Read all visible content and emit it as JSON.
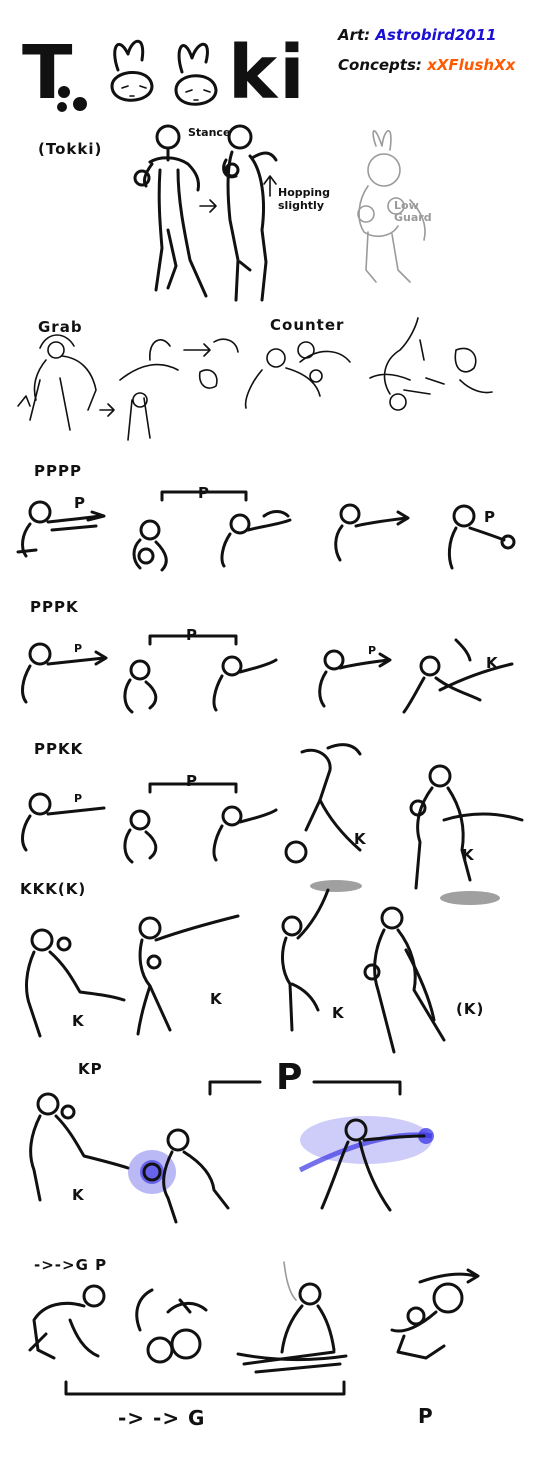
{
  "header": {
    "title_left": "T",
    "title_right": "ki",
    "subtitle": "(Tokki)",
    "art_label": "Art:",
    "art_value": "Astrobird2011",
    "concepts_label": "Concepts:",
    "concepts_value": "xXFlushXx",
    "art_color": "#1a10d6",
    "concepts_color": "#ff5a00"
  },
  "stance": {
    "label": "Stance",
    "hop_note": "Hopping slightly",
    "low_note": "Low Guard"
  },
  "moves": [
    {
      "id": "grab",
      "label": "Grab"
    },
    {
      "id": "counter",
      "label": "Counter"
    },
    {
      "id": "pppp",
      "label": "PPPP",
      "bracket": "P",
      "marks": [
        "P",
        "P"
      ]
    },
    {
      "id": "pppk",
      "label": "PPPK",
      "bracket": "P",
      "marks": [
        "P",
        "P",
        "K"
      ]
    },
    {
      "id": "ppkk",
      "label": "PPKK",
      "bracket": "P",
      "marks": [
        "P",
        "K",
        "K"
      ]
    },
    {
      "id": "kkkk",
      "label": "KKK(K)",
      "marks": [
        "K",
        "K",
        "K",
        "(K)"
      ]
    },
    {
      "id": "kp",
      "label": "KP",
      "bracket": "P",
      "marks": [
        "K"
      ]
    },
    {
      "id": "ffgp",
      "label": "->->G P",
      "bottom": "-> -> G",
      "end": "P"
    }
  ],
  "colors": {
    "ink": "#111111",
    "glow": "#3b35e6",
    "grey": "#9a9a9a"
  }
}
